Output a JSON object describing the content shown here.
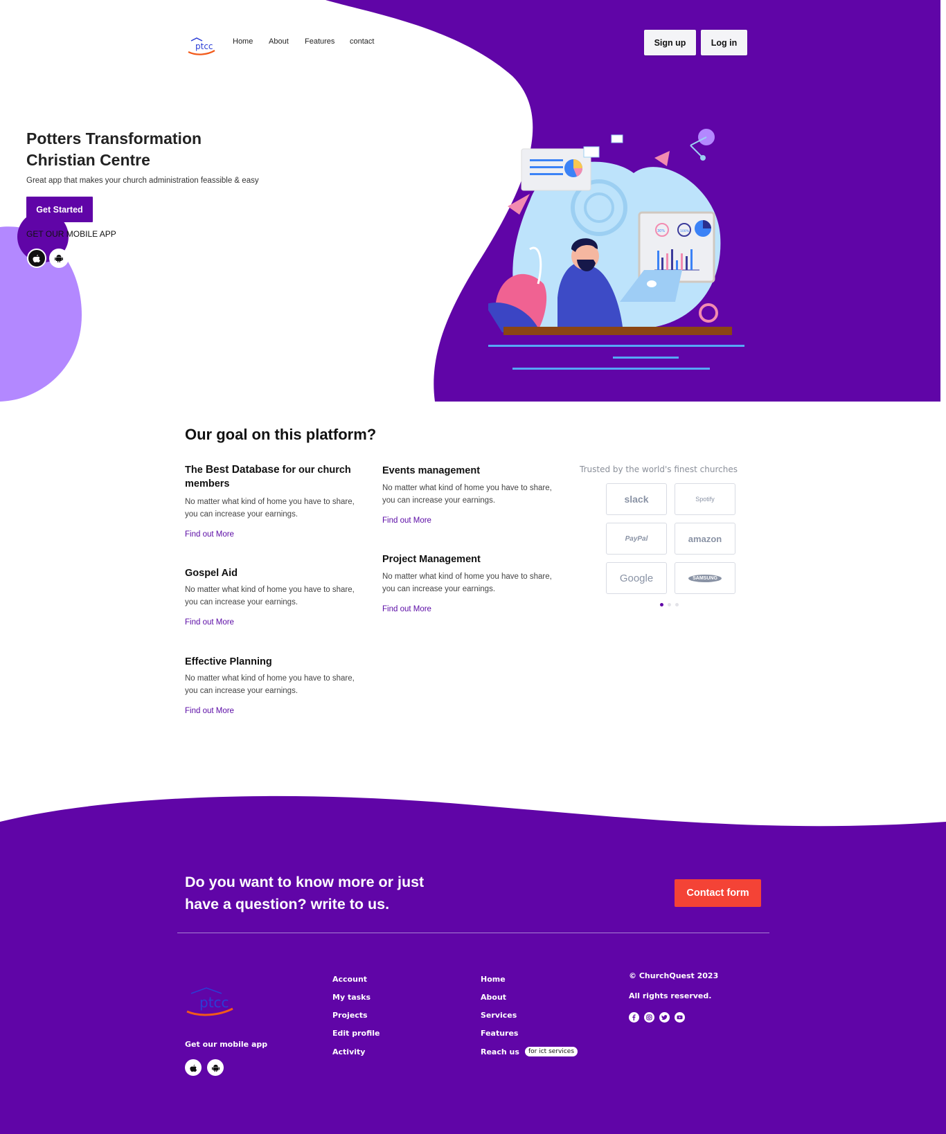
{
  "nav": {
    "logo_text": "ptcc",
    "links": [
      "Home",
      "About",
      "Features",
      "contact"
    ],
    "signup_label": "Sign up",
    "login_label": "Log in"
  },
  "hero": {
    "title_line1": "Potters Transformation",
    "title_line2": "Christian Centre",
    "subtitle": "Great app that makes your church administration feassible & easy",
    "cta_label": "Get Started",
    "mobile_label": "GET OUR MOBILE APP",
    "illustration_labels": [
      "30%",
      "100%"
    ]
  },
  "goals": {
    "heading": "Our goal on this platform?",
    "items": [
      {
        "title_pre": "The ",
        "title_bold": "Best Database",
        "title_post": " for our church members",
        "text": "No matter what kind of home you have to share, you can increase your earnings.",
        "link": "Find out More"
      },
      {
        "title": "Gospel Aid",
        "text": "No matter what kind of home you have to share, you can increase your earnings.",
        "link": "Find out More"
      },
      {
        "title": "Effective Planning",
        "text": "No matter what kind of home you have to share, you can increase your earnings.",
        "link": "Find out More"
      },
      {
        "title": "Events management",
        "text": "No matter what kind of home you have to share, you can increase your earnings.",
        "link": "Find out More"
      },
      {
        "title": "Project Management",
        "text": "No matter what kind of home you have to share, you can increase your earnings.",
        "link": "Find out More"
      }
    ]
  },
  "trusted": {
    "heading": "Trusted by the world's finest churches",
    "logos": [
      "slack",
      "Spotify",
      "PayPal",
      "amazon",
      "Google",
      "SAMSUNG"
    ]
  },
  "cta": {
    "text_line1": "Do you want to know more or just",
    "text_line2": "have a question? write to us.",
    "button_label": "Contact form"
  },
  "footer": {
    "logo_text": "ptcc",
    "mobile_label": "Get our mobile app",
    "col1": [
      "Account",
      "My tasks",
      "Projects",
      "Edit profile",
      "Activity"
    ],
    "col2": [
      "Home",
      "About",
      "Services",
      "Features",
      "Reach us"
    ],
    "reach_badge": "for ict services",
    "copyright": "© ChurchQuest 2023",
    "rights": "All rights reserved."
  },
  "colors": {
    "purple": "#6005a7",
    "lavender": "#b388ff",
    "contact_red": "#f44336"
  },
  "icons": [
    "apple-icon",
    "android-icon",
    "facebook-icon",
    "instagram-icon",
    "twitter-icon",
    "youtube-icon"
  ]
}
